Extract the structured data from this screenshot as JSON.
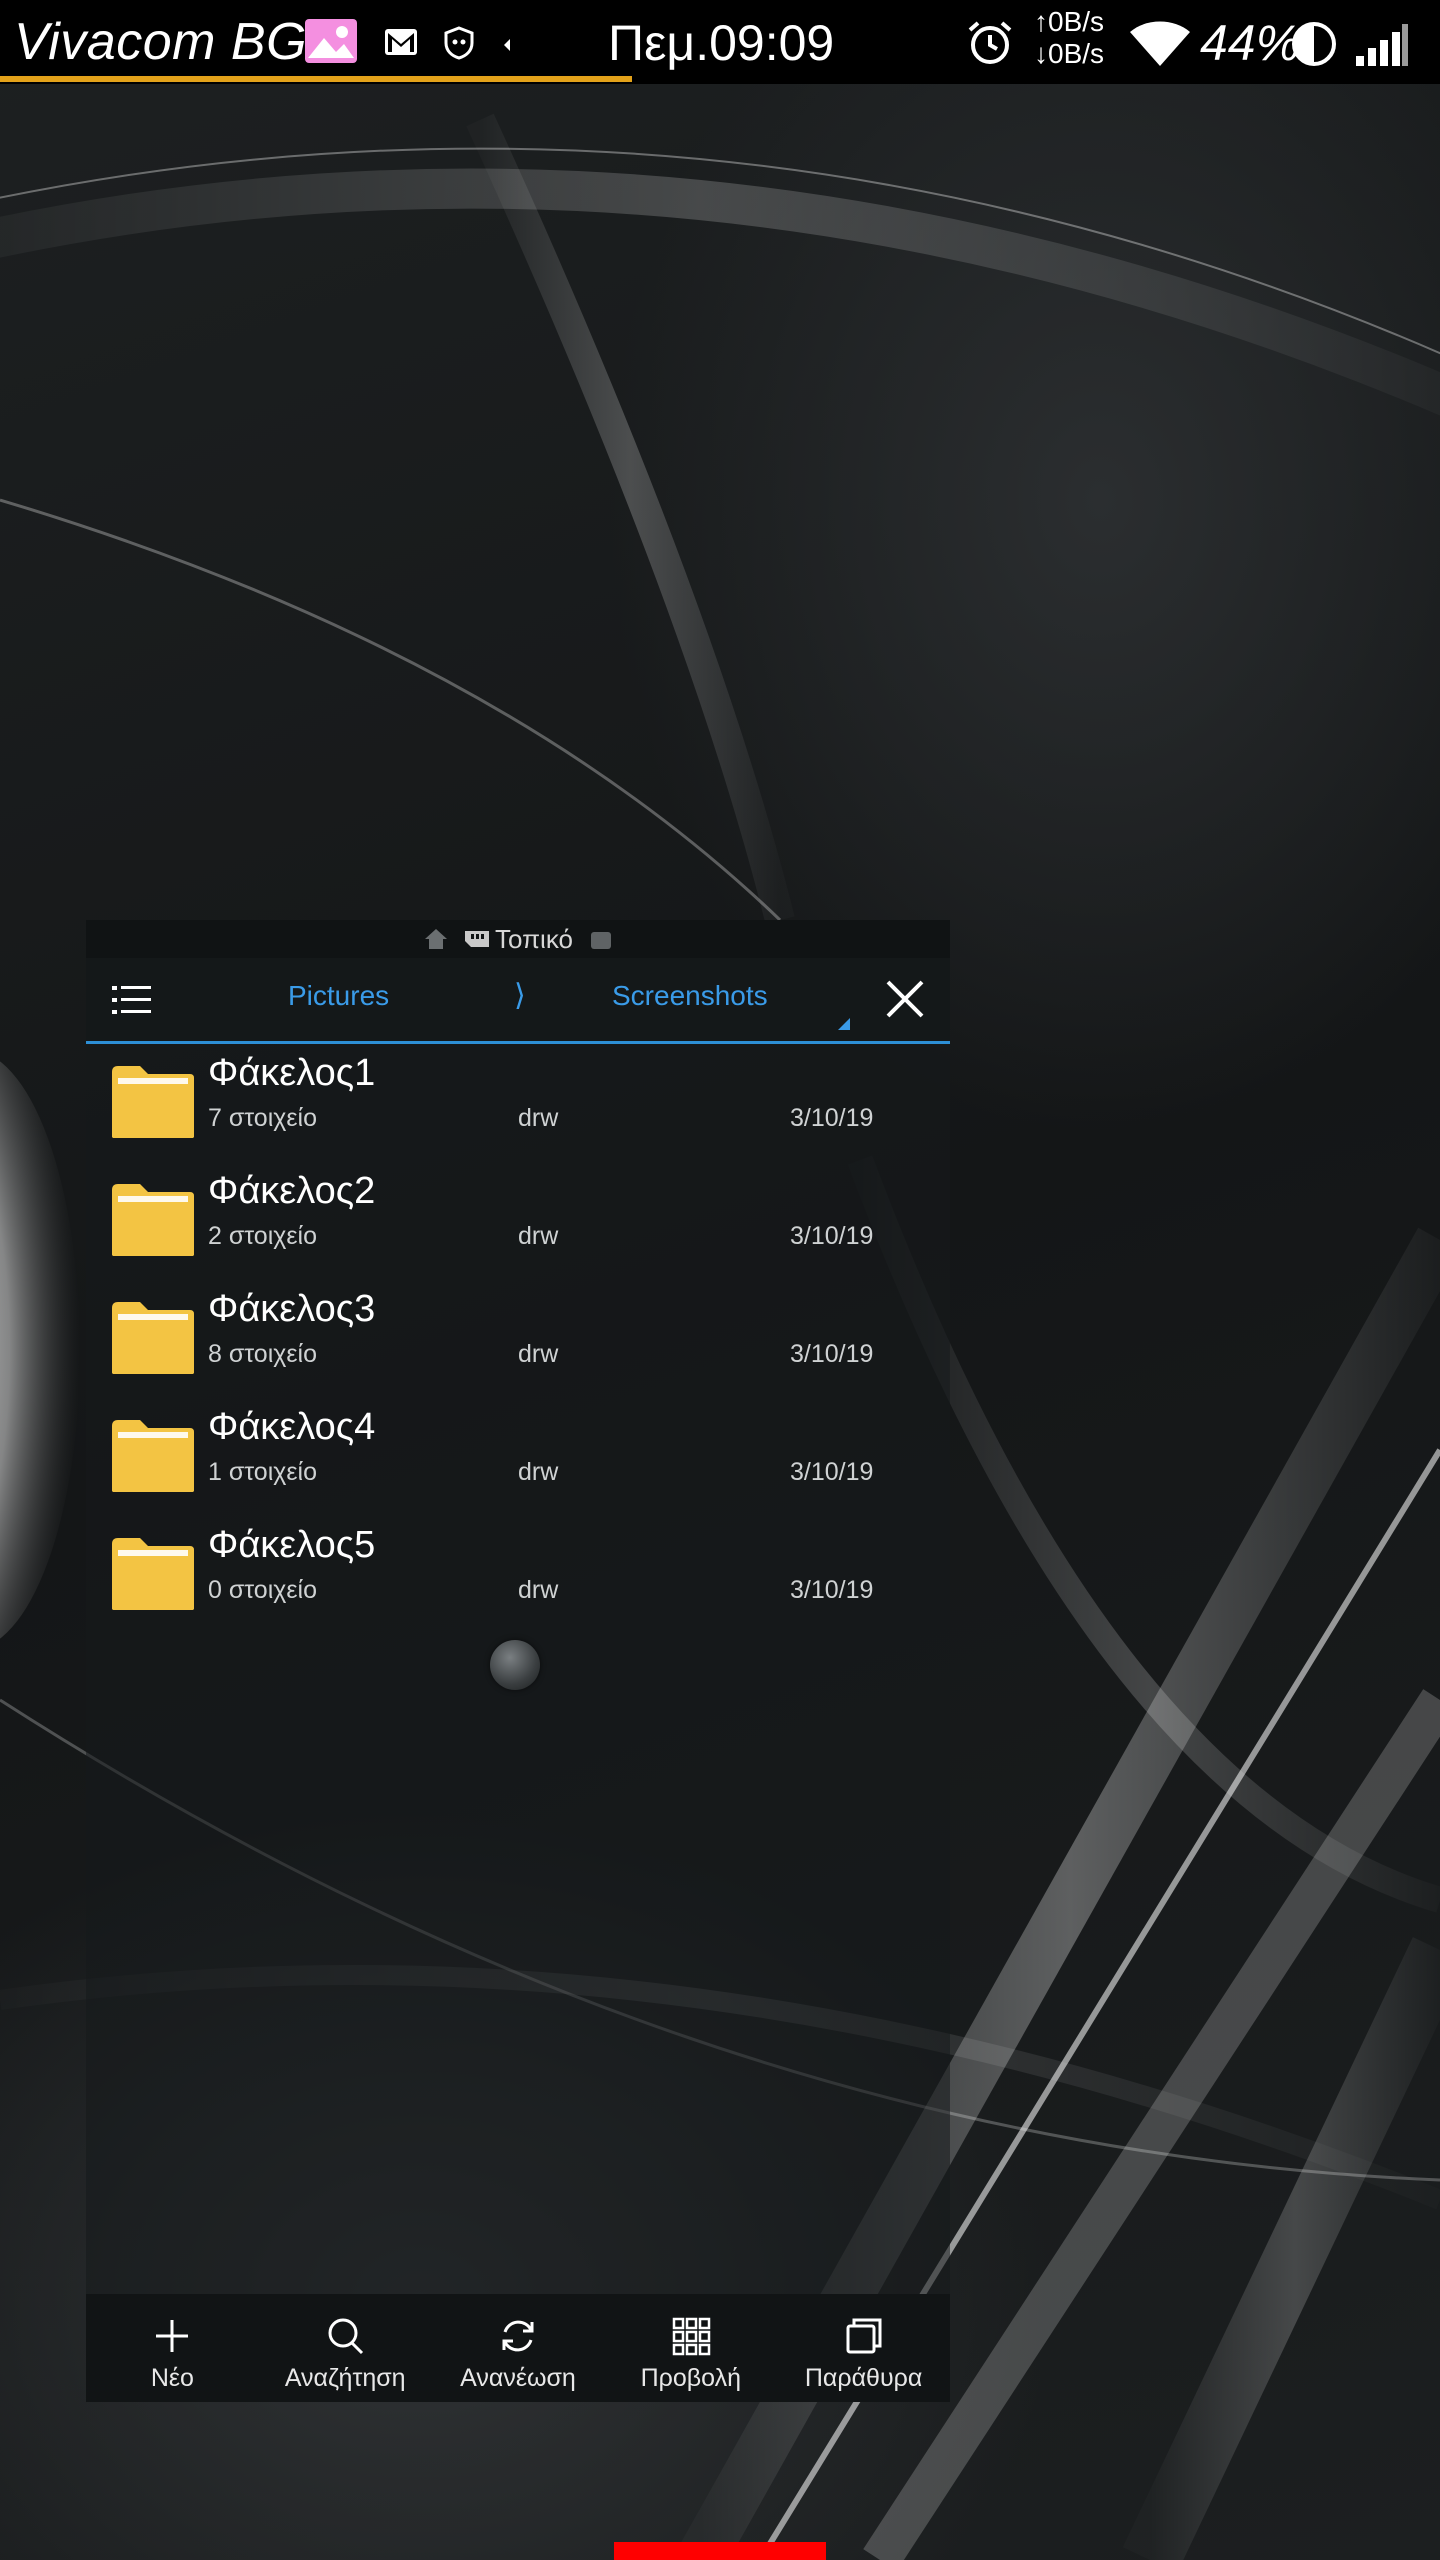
{
  "status_bar": {
    "carrier": "Vivacom BG",
    "time": "Πεμ.09:09",
    "speed_up": "↑0B/s",
    "speed_down": "↓0B/s",
    "battery": "44%",
    "icons": [
      "picture-notification-icon",
      "gmail-icon",
      "shield-icon",
      "dot-icon",
      "alarm-icon",
      "wifi-icon",
      "battery-icon",
      "signal-icon"
    ],
    "progress_fraction": 0.44
  },
  "window": {
    "location_label": "Τοπικό",
    "breadcrumb": [
      "Pictures",
      "Screenshots"
    ],
    "separator": "⟩",
    "folders": [
      {
        "name": "Φάκελος1",
        "count": "7 στοιχείο",
        "perm": "drw",
        "date": "3/10/19"
      },
      {
        "name": "Φάκελος2",
        "count": "2 στοιχείο",
        "perm": "drw",
        "date": "3/10/19"
      },
      {
        "name": "Φάκελος3",
        "count": "8 στοιχείο",
        "perm": "drw",
        "date": "3/10/19"
      },
      {
        "name": "Φάκελος4",
        "count": "1 στοιχείο",
        "perm": "drw",
        "date": "3/10/19"
      },
      {
        "name": "Φάκελος5",
        "count": "0 στοιχείο",
        "perm": "drw",
        "date": "3/10/19"
      }
    ],
    "bottom_bar": {
      "new": "Νέο",
      "search": "Αναζήτηση",
      "refresh": "Ανανέωση",
      "view": "Προβολή",
      "windows": "Παράθυρα"
    }
  },
  "colors": {
    "accent": "#2d8fd6",
    "folder": "#f3c443",
    "progress": "#e3a21a",
    "nav_indicator": "#ff0000"
  }
}
